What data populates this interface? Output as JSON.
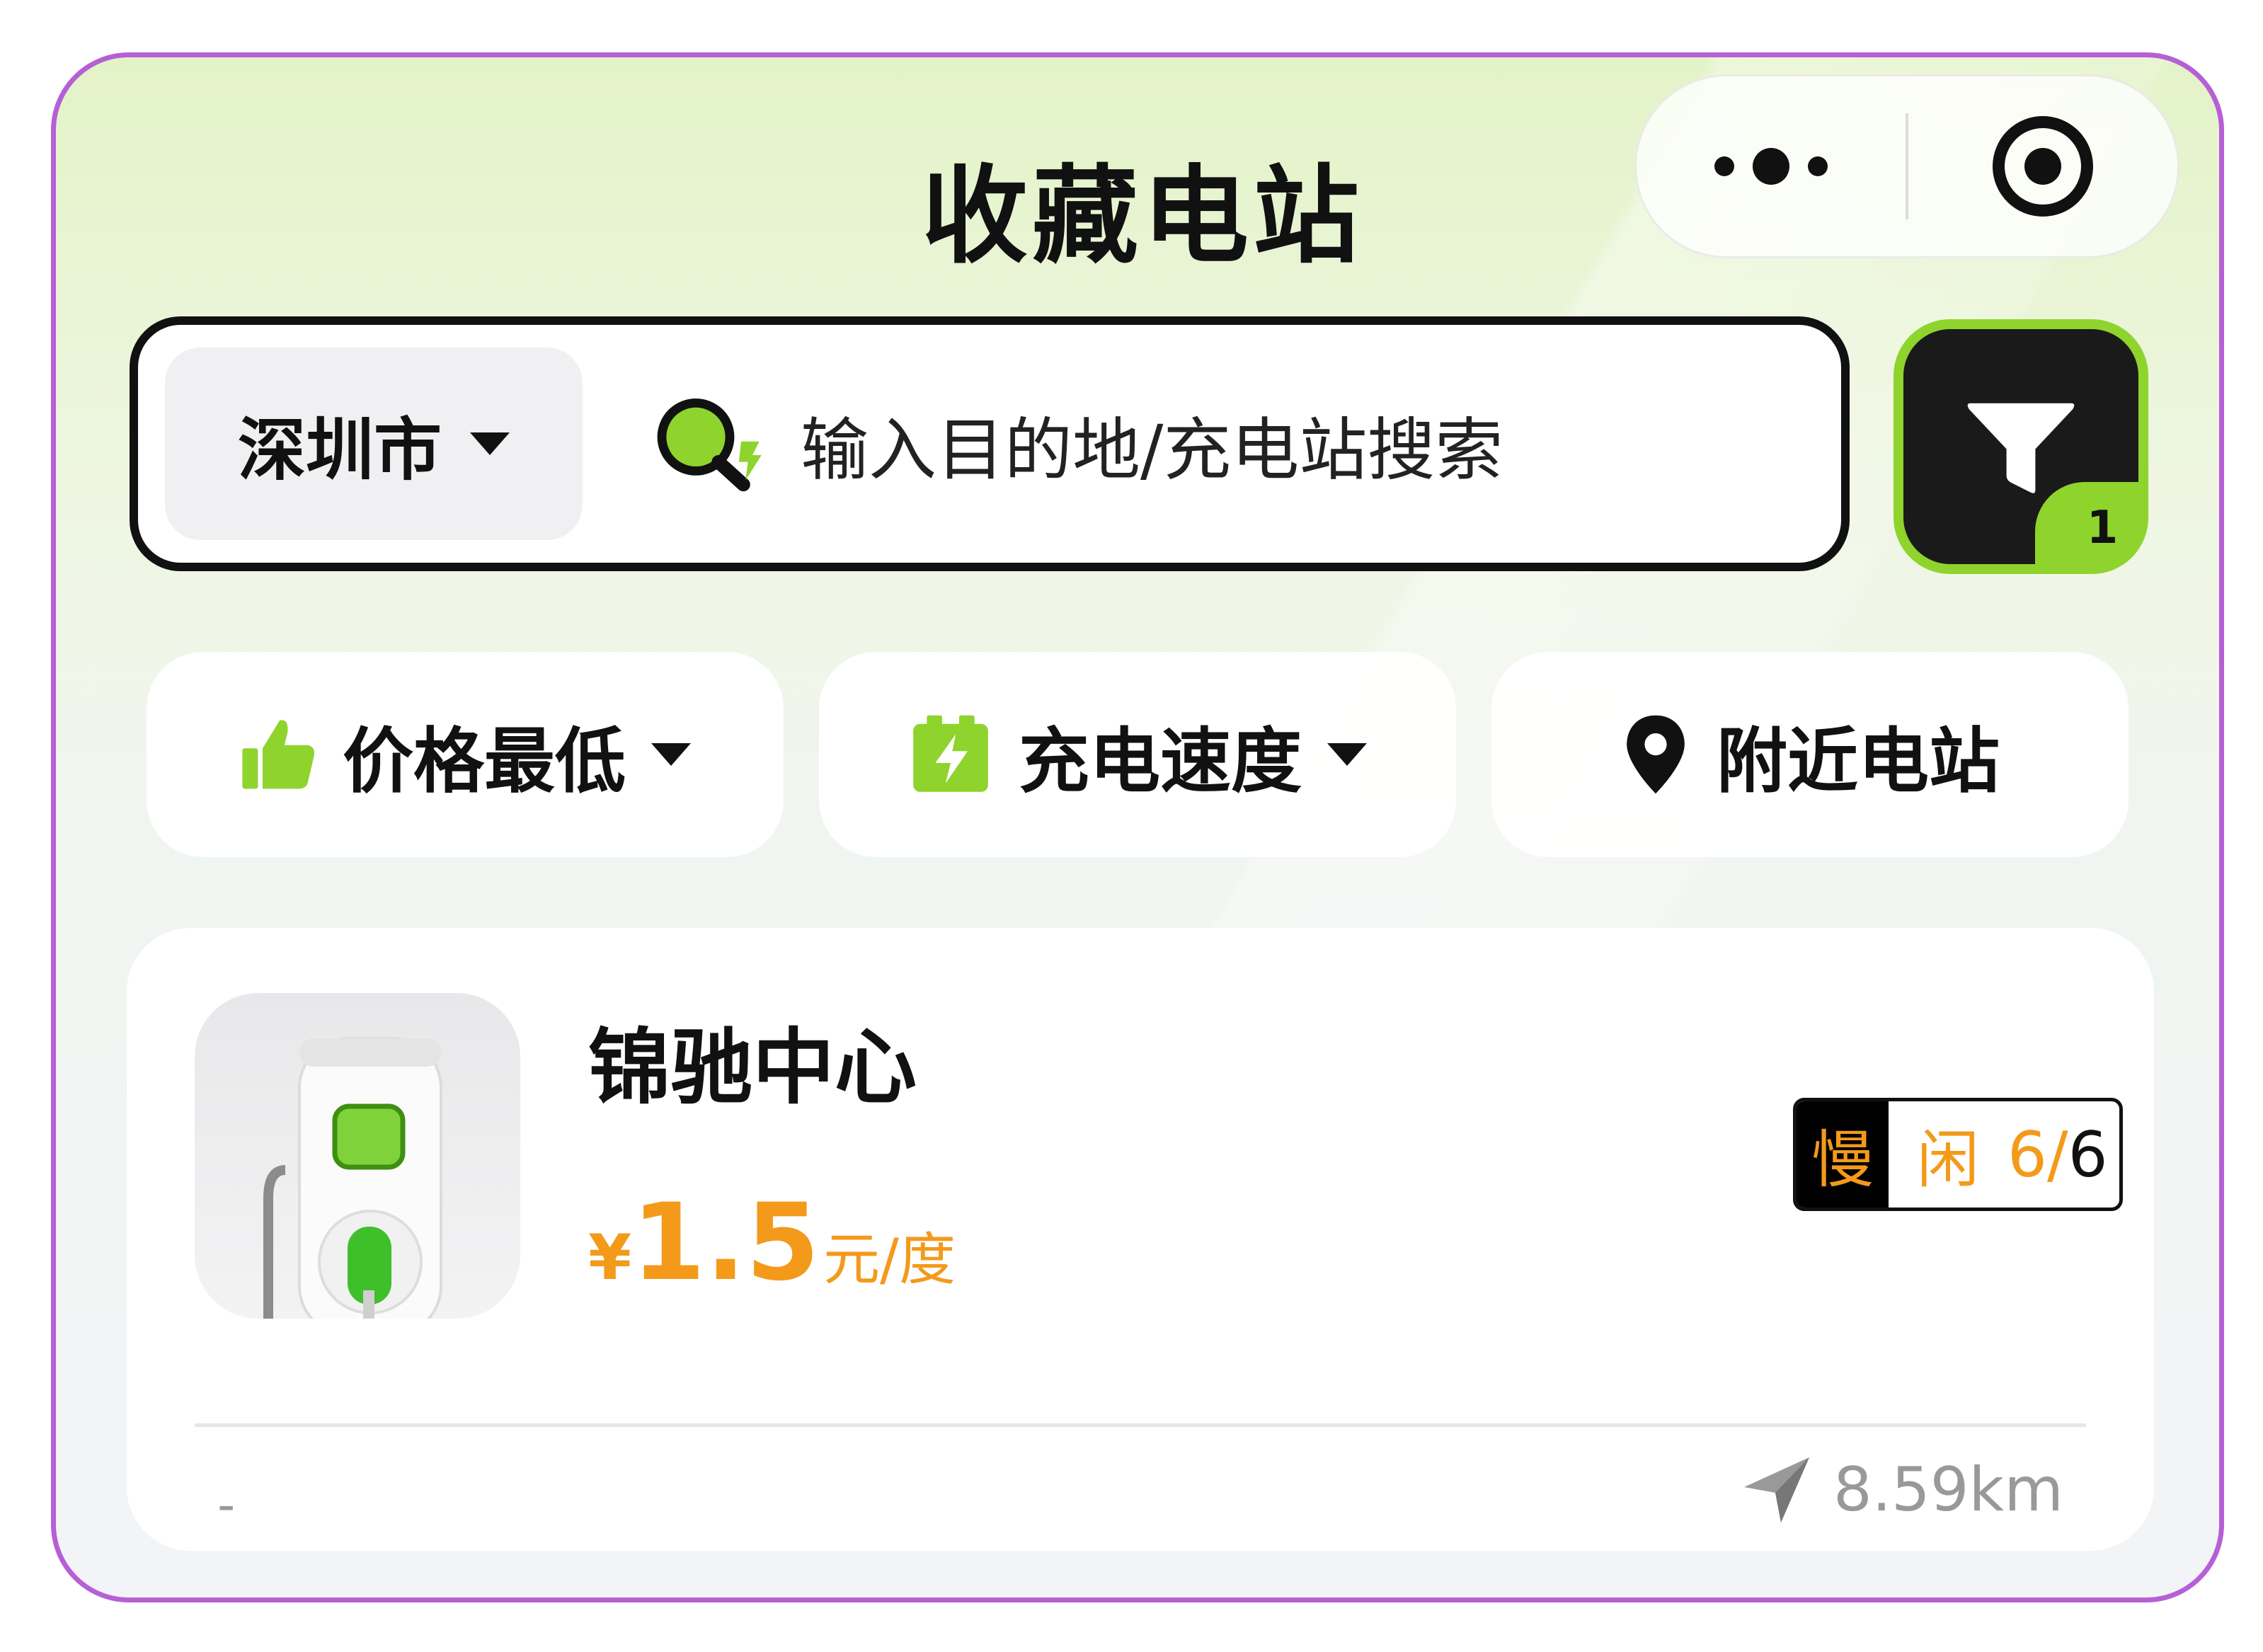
{
  "header": {
    "title": "收藏电站"
  },
  "capsule": {
    "more": "more-dots-icon",
    "close": "target-icon"
  },
  "search": {
    "city": "深圳市",
    "placeholder": "输入目的地/充电站搜索"
  },
  "filter": {
    "badge": "1"
  },
  "chips": [
    {
      "label": "价格最低",
      "icon": "thumbs-up-icon"
    },
    {
      "label": "充电速度",
      "icon": "battery-bolt-icon"
    },
    {
      "label": "附近电站",
      "icon": "location-pin-icon"
    }
  ],
  "station": {
    "name": "锦驰中心",
    "currency": "¥",
    "price": "1.5",
    "unit": "元/度",
    "type": "慢",
    "status": "闲",
    "available": "6/",
    "total": "6",
    "address": "-",
    "distance": "8.59km"
  },
  "colors": {
    "accent": "#8fd32d",
    "price": "#f39a1b",
    "border": "#b65fd6"
  }
}
